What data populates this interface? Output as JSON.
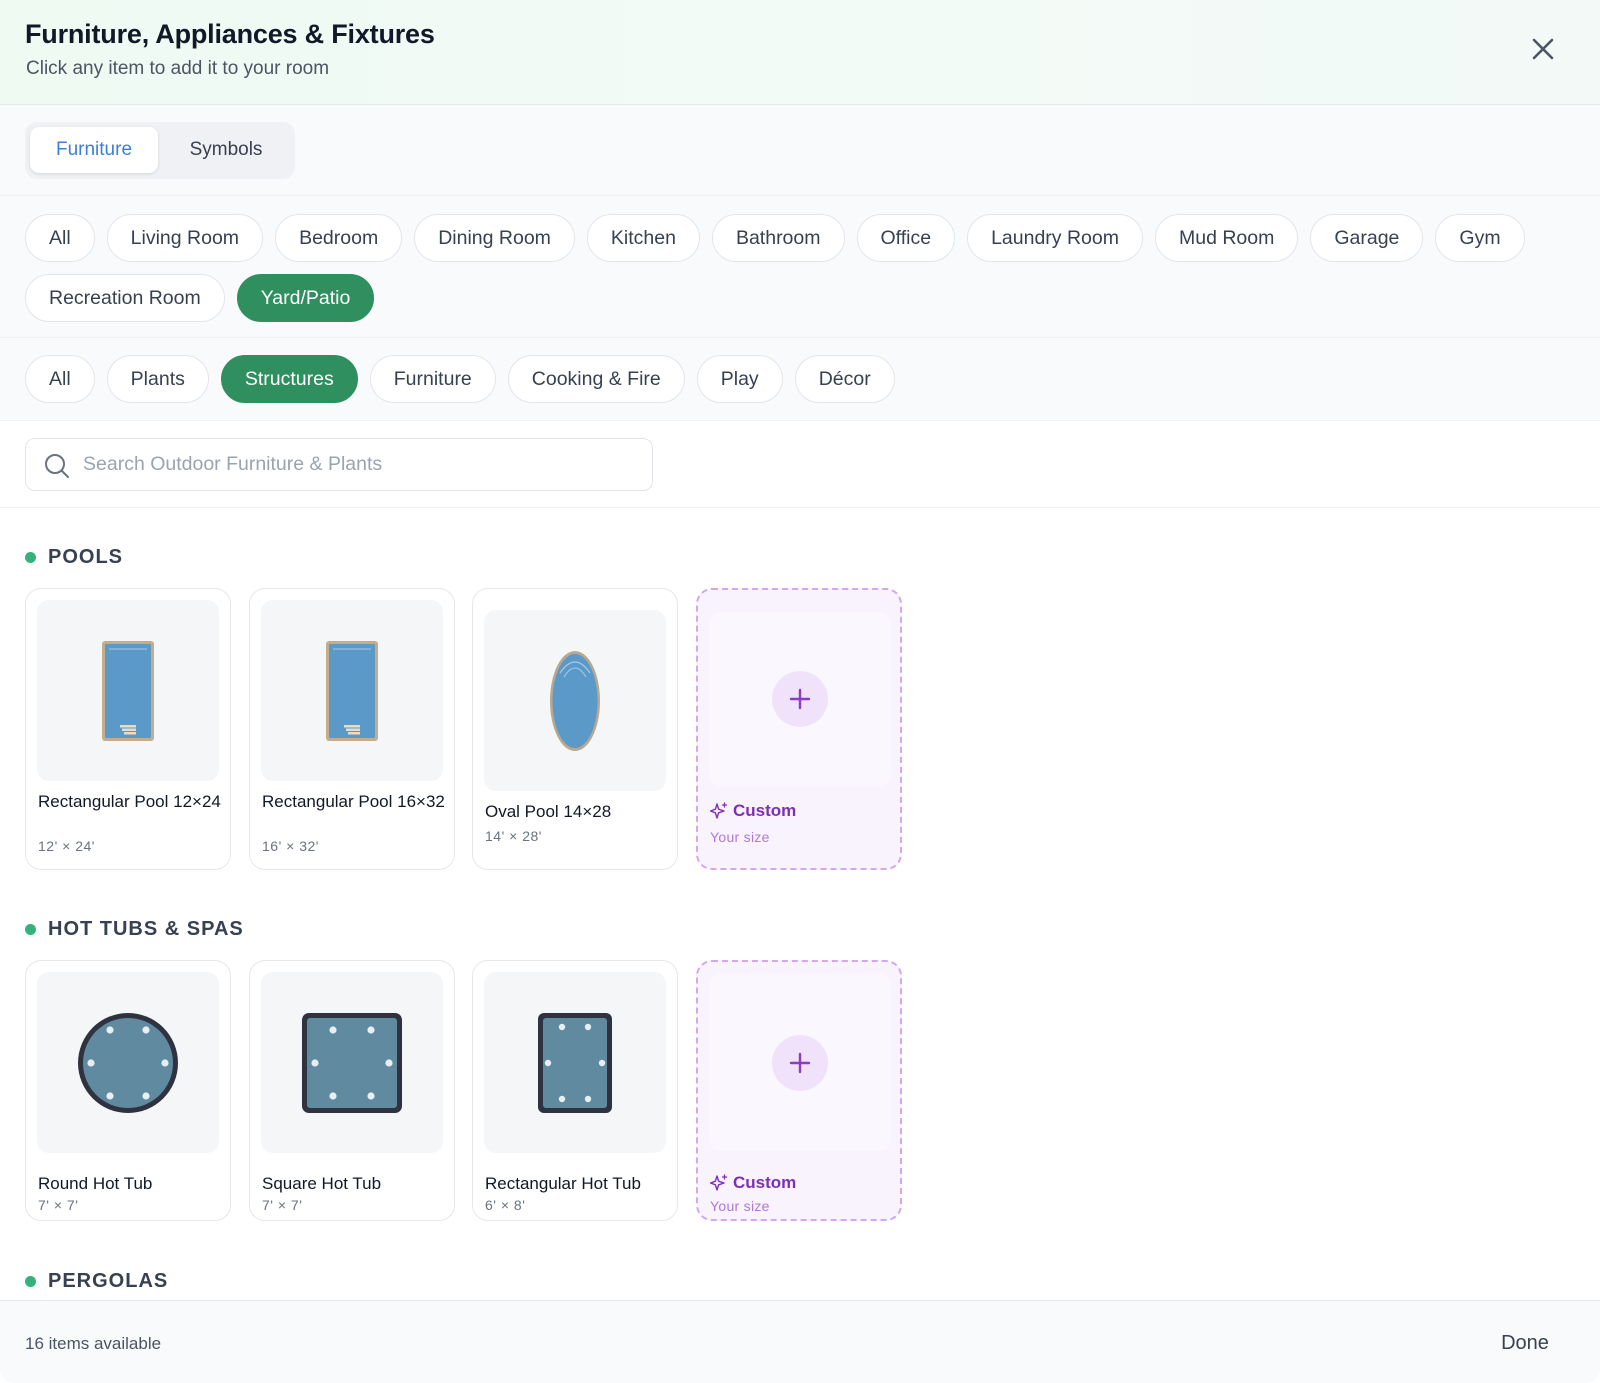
{
  "header": {
    "title": "Furniture, Appliances & Fixtures",
    "subtitle": "Click any item to add it to your room"
  },
  "tabs": [
    {
      "label": "Furniture",
      "active": true
    },
    {
      "label": "Symbols",
      "active": false
    }
  ],
  "rooms": [
    "All",
    "Living Room",
    "Bedroom",
    "Dining Room",
    "Kitchen",
    "Bathroom",
    "Office",
    "Laundry Room",
    "Mud Room",
    "Garage",
    "Gym",
    "Recreation Room",
    "Yard/Patio"
  ],
  "rooms_active": "Yard/Patio",
  "subcategories": [
    "All",
    "Plants",
    "Structures",
    "Furniture",
    "Cooking & Fire",
    "Play",
    "Décor"
  ],
  "subcategories_active": "Structures",
  "search": {
    "placeholder": "Search Outdoor Furniture & Plants",
    "value": ""
  },
  "sections": [
    {
      "title": "POOLS",
      "items": [
        {
          "name": "Rectangular Pool 12×24",
          "size": "12' × 24'",
          "icon": "rect-pool-icon"
        },
        {
          "name": "Rectangular Pool 16×32",
          "size": "16' × 32'",
          "icon": "rect-pool-icon"
        },
        {
          "name": "Oval Pool 14×28",
          "size": "14' × 28'",
          "icon": "oval-pool-icon"
        }
      ],
      "custom": {
        "label": "Custom",
        "sub": "Your size"
      }
    },
    {
      "title": "HOT TUBS & SPAS",
      "items": [
        {
          "name": "Round Hot Tub",
          "size": "7' × 7'",
          "icon": "round-hot-tub-icon"
        },
        {
          "name": "Square Hot Tub",
          "size": "7' × 7'",
          "icon": "square-hot-tub-icon"
        },
        {
          "name": "Rectangular Hot Tub",
          "size": "6' × 8'",
          "icon": "rect-hot-tub-icon"
        }
      ],
      "custom": {
        "label": "Custom",
        "sub": "Your size"
      }
    },
    {
      "title": "PERGOLAS",
      "items": []
    }
  ],
  "footer": {
    "count": "16 items available",
    "done": "Done"
  },
  "colors": {
    "accent_green": "#2f8f5f",
    "tab_blue": "#3b7fd6",
    "custom_purple": "#7e2fb4",
    "pool_blue": "#5b9ac8",
    "tub_blue": "#5f8aa0"
  }
}
